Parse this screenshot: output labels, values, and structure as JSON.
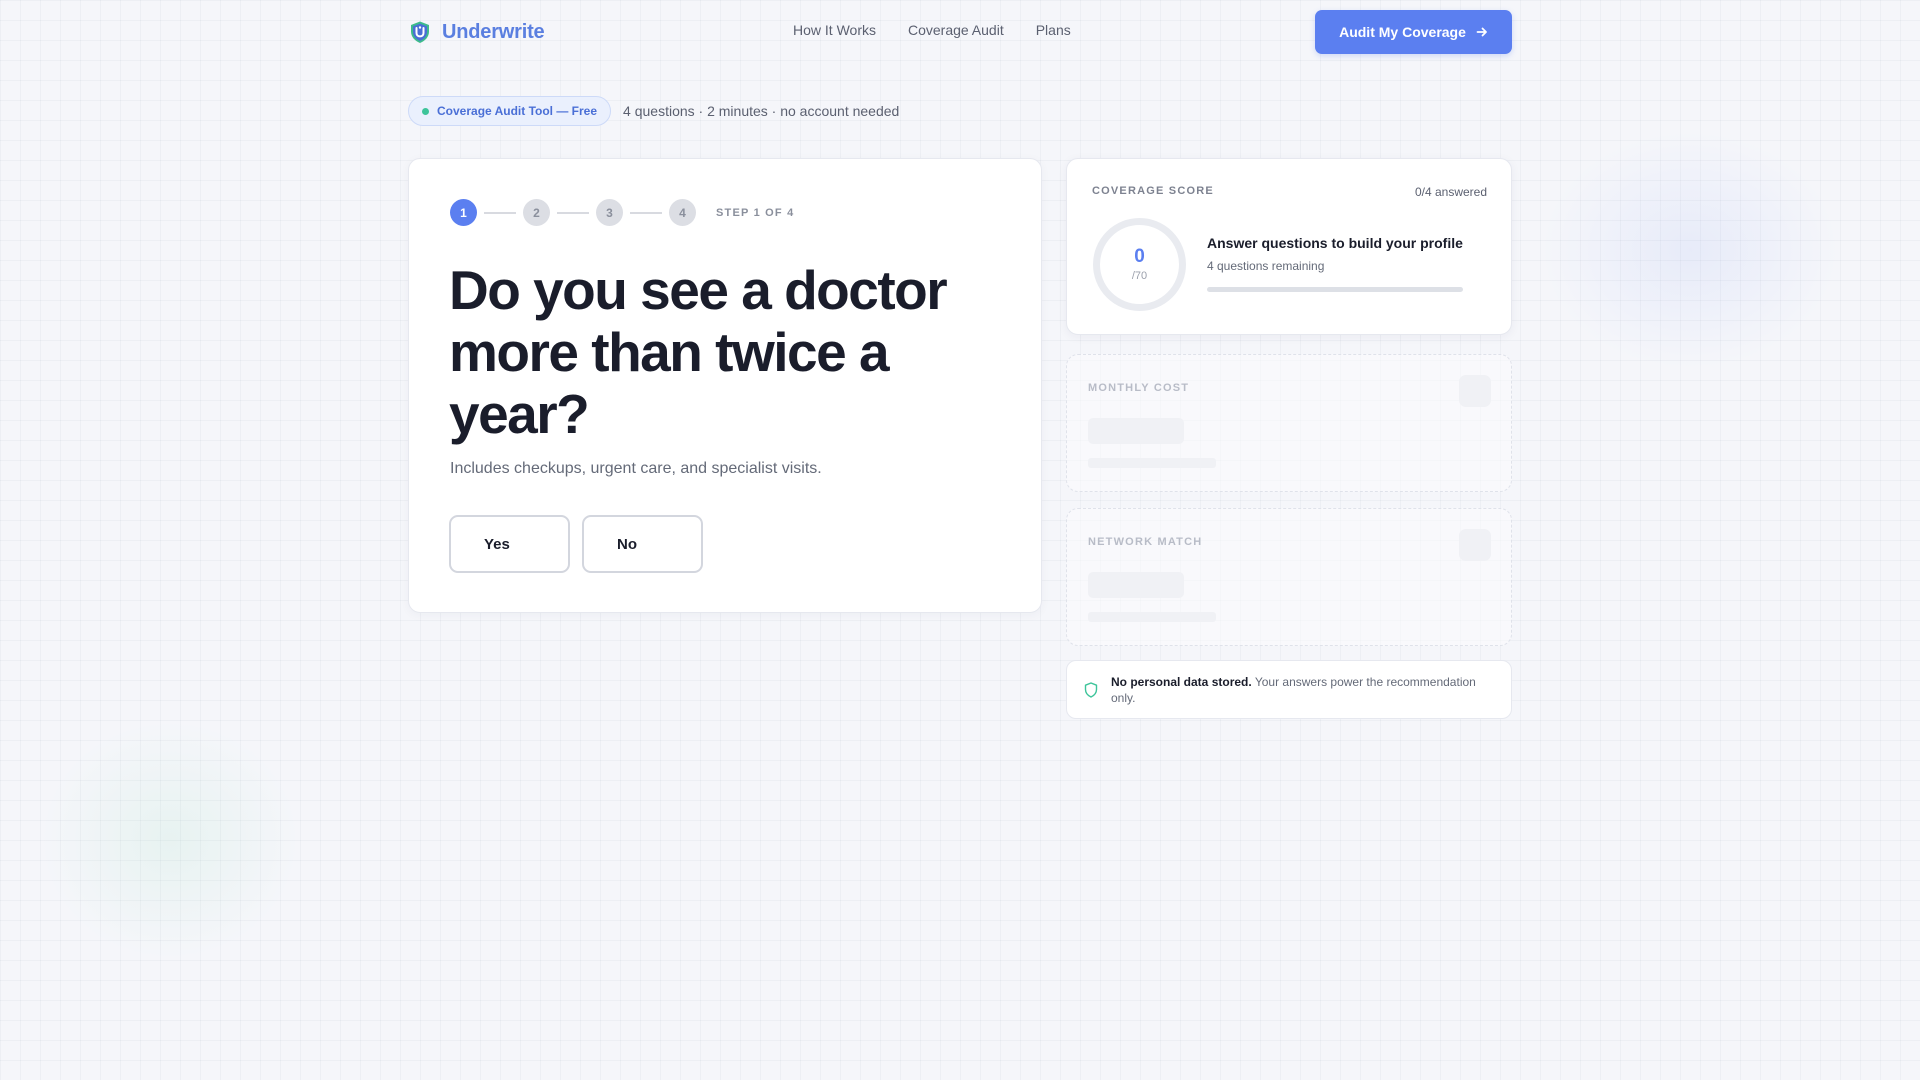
{
  "header": {
    "brand_name": "Underwrite",
    "nav": [
      "How It Works",
      "Coverage Audit",
      "Plans"
    ],
    "cta_label": "Audit My Coverage",
    "cta_icon": "arrow-right-icon",
    "logo_icon": "shield-logo-icon"
  },
  "intro": {
    "badge": "Coverage Audit Tool — Free",
    "meta": "4 questions · 2 minutes · no account needed"
  },
  "question_card": {
    "steps": [
      "1",
      "2",
      "3",
      "4"
    ],
    "current_step": 1,
    "step_label": "STEP 1 OF 4",
    "question": "Do you see a doctor more than twice a year?",
    "subtext": "Includes checkups, urgent care, and specialist visits.",
    "answers": [
      "Yes",
      "No"
    ]
  },
  "score_card": {
    "title": "COVERAGE SCORE",
    "answered": "0/4 answered",
    "score": "0",
    "score_max": "/70",
    "profile_title": "Answer questions to build your profile",
    "profile_sub": "4 questions remaining",
    "progress": 0
  },
  "locked_cards": [
    {
      "title": "MONTHLY COST"
    },
    {
      "title": "NETWORK MATCH"
    }
  ],
  "privacy": {
    "strong": "No personal data stored.",
    "text": " Your answers power the recommendation only.",
    "icon": "shield-icon"
  },
  "colors": {
    "accent": "#5b7ff0",
    "brand": "#5a7fe0",
    "success": "#3dc49a",
    "text": "#1a1d2b",
    "muted": "#646a78"
  }
}
